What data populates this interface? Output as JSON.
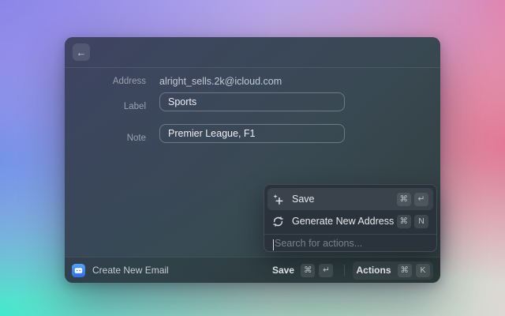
{
  "colors": {
    "accent_blue": "#3b82f6",
    "bg_corner_top_left": "#8b86e9",
    "bg_corner_top_right": "#e87fa6",
    "bg_corner_bottom_left": "#43e8cc",
    "bg_corner_bottom_right": "#f2d8d8",
    "window_top": "#3c425f",
    "window_bottom": "#2c3c3c"
  },
  "window": {
    "back_button": {
      "glyph": "←"
    },
    "form": {
      "rows": [
        {
          "label": "Address",
          "value": "alright_sells.2k@icloud.com"
        },
        {
          "label": "Label",
          "value": "Sports"
        },
        {
          "label": "Note",
          "value": "Premier League, F1"
        }
      ]
    },
    "actions_popover": {
      "items": [
        {
          "icon": "sparkle-plus-icon",
          "label": "Save",
          "keys": [
            "⌘",
            "↵"
          ],
          "selected": true
        },
        {
          "icon": "refresh-icon",
          "label": "Generate New Address",
          "keys": [
            "⌘",
            "N"
          ],
          "selected": false
        }
      ],
      "search_placeholder": "Search for actions..."
    },
    "bottom_bar": {
      "title": "Create New Email",
      "save": {
        "label": "Save",
        "keys": [
          "⌘",
          "↵"
        ]
      },
      "actions": {
        "label": "Actions",
        "keys": [
          "⌘",
          "K"
        ]
      }
    }
  }
}
